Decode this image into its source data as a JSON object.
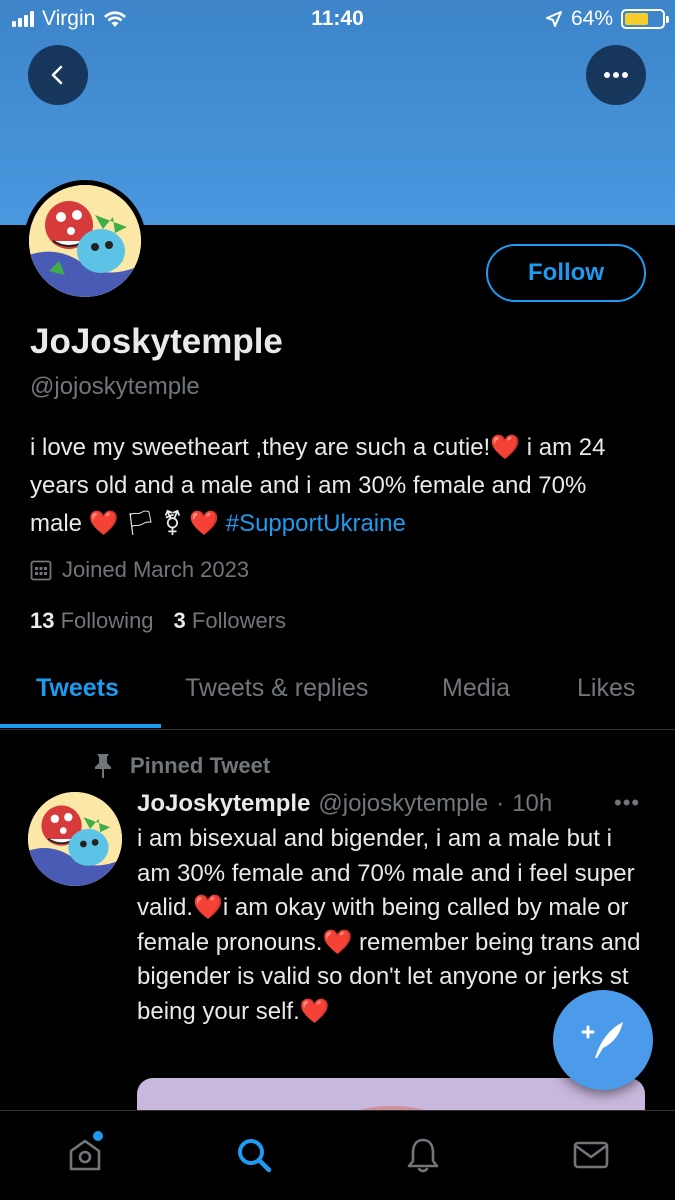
{
  "status_bar": {
    "carrier": "Virgin",
    "time": "11:40",
    "battery_percent": "64%",
    "battery_level": 0.64
  },
  "profile": {
    "follow_label": "Follow",
    "display_name": "JoJoskytemple",
    "handle": "@jojoskytemple",
    "bio_line1": "i love my sweetheart ,they are such a cutie!",
    "bio_line1_tail": " i am 24 years old and a male and i am 30% female and 70% male ",
    "bio_symbols": "⚧",
    "hashtag": "#SupportUkraine",
    "joined": "Joined March 2023",
    "following_count": "13",
    "following_label": "Following",
    "followers_count": "3",
    "followers_label": "Followers"
  },
  "tabs": [
    {
      "label": "Tweets"
    },
    {
      "label": "Tweets & replies"
    },
    {
      "label": "Media"
    },
    {
      "label": "Likes"
    }
  ],
  "pinned_tweet": {
    "pinned_label": "Pinned Tweet",
    "author_name": "JoJoskytemple",
    "author_handle": "@jojoskytemple",
    "time_ago": "10h",
    "text_1": "i am bisexual and bigender, i am a male but i am 30% female and 70% male and i feel super valid.",
    "text_2": "i am okay with being called by male or female pronouns.",
    "text_3": " remember being trans and bigender is valid so don't let anyone or jerks st",
    "text_4": " being your self."
  },
  "colors": {
    "accent": "#1d9bf0",
    "banner": "#4a98e0",
    "heart": "#e0245e"
  },
  "icons": {
    "back": "chevron-left-icon",
    "more": "more-horizontal-icon",
    "compose": "compose-tweet-icon",
    "home": "home-icon",
    "search": "search-icon",
    "notifications": "bell-icon",
    "messages": "mail-icon"
  }
}
